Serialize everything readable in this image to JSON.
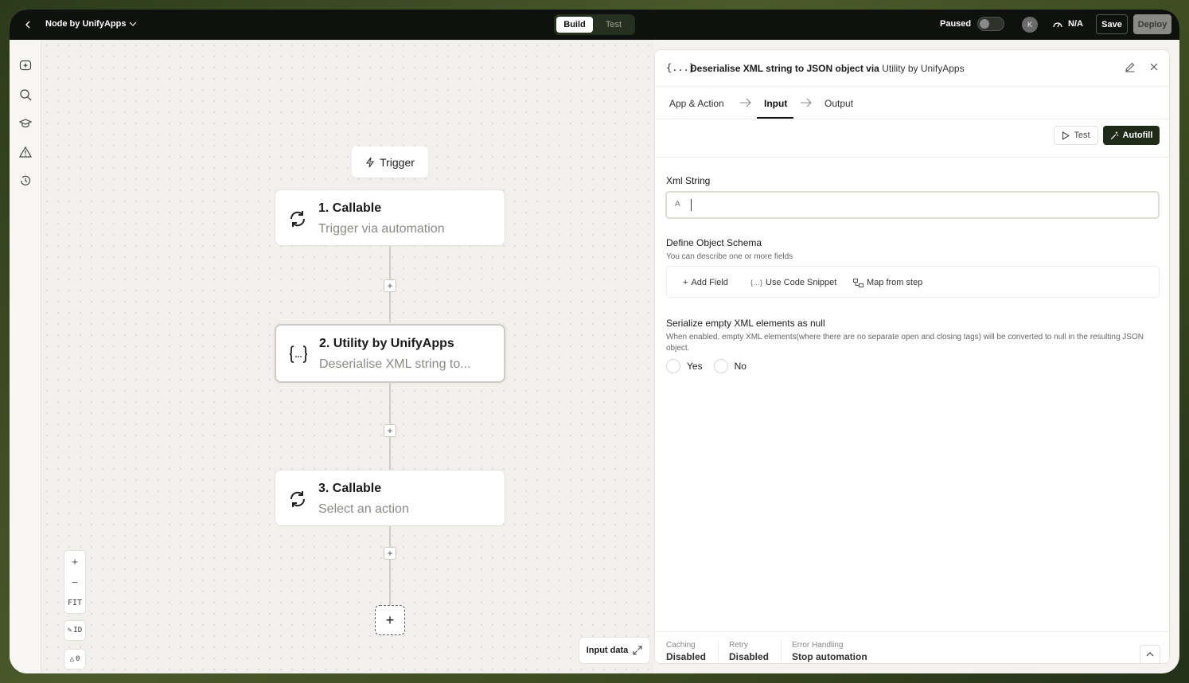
{
  "topbar": {
    "project_name": "Node by UnifyApps",
    "modes": [
      "Build",
      "Test"
    ],
    "paused_label": "Paused",
    "avatar_initial": "K",
    "speed_value": "N/A",
    "save_label": "Save",
    "deploy_label": "Deploy"
  },
  "rail": {
    "icons": [
      "ai-sparkle-icon",
      "search-icon",
      "graduation-cap-icon",
      "warning-icon",
      "history-icon"
    ]
  },
  "canvas": {
    "trigger_label": "Trigger",
    "nodes": [
      {
        "title": "1. Callable",
        "subtitle": "Trigger via automation",
        "icon": "sync-icon"
      },
      {
        "title": "2. Utility by UnifyApps",
        "subtitle": "Deserialise XML string to...",
        "icon": "braces-icon"
      },
      {
        "title": "3. Callable",
        "subtitle": "Select an action",
        "icon": "sync-icon"
      }
    ],
    "zoom_in": "+",
    "zoom_out": "−",
    "fit_label": "FIT",
    "id_label": "ID",
    "warning_count": "0",
    "input_data_label": "Input data"
  },
  "panel": {
    "header_icon": "{...}",
    "title_main": "Deserialise XML string to JSON object via",
    "title_app": "Utility by UnifyApps",
    "tabs": [
      "App & Action",
      "Input",
      "Output"
    ],
    "test_label": "Test",
    "autofill_label": "Autofill",
    "xml_label": "Xml String",
    "schema_label": "Define Object Schema",
    "schema_desc": "You can describe one or more fields",
    "schema_actions": [
      "Add Field",
      "Use Code Snippet",
      "Map from step"
    ],
    "serialize_label": "Serialize empty XML elements as null",
    "serialize_desc": "When enabled, empty XML elements(where there are no separate open and closing tags) will be converted to null in the resulting JSON object.",
    "radio_options": [
      "Yes",
      "No"
    ],
    "footer": [
      {
        "label": "Caching",
        "value": "Disabled"
      },
      {
        "label": "Retry",
        "value": "Disabled"
      },
      {
        "label": "Error Handling",
        "value": "Stop automation"
      }
    ]
  }
}
